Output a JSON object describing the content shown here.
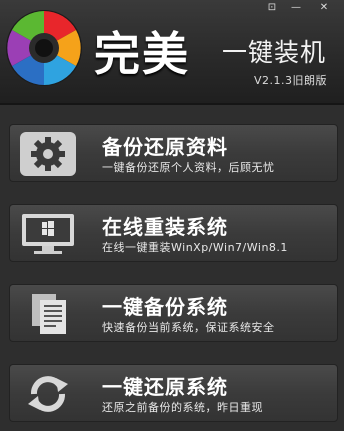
{
  "header": {
    "title_main": "完美",
    "title_sub": "一键装机",
    "version": "V2.1.3旧朗版",
    "controls": {
      "menu": "⊡",
      "minimize": "—",
      "close": "✕"
    }
  },
  "menu_items": [
    {
      "title": "备份还原资料",
      "desc": "一键备份还原个人资料，后顾无忧",
      "icon": "gear-icon"
    },
    {
      "title": "在线重装系统",
      "desc": "在线一键重装WinXp/Win7/Win8.1",
      "icon": "monitor-windows-icon"
    },
    {
      "title": "一键备份系统",
      "desc": "快速备份当前系统，保证系统安全",
      "icon": "documents-icon"
    },
    {
      "title": "一键还原系统",
      "desc": "还原之前备份的系统，昨日重现",
      "icon": "refresh-icon"
    }
  ]
}
